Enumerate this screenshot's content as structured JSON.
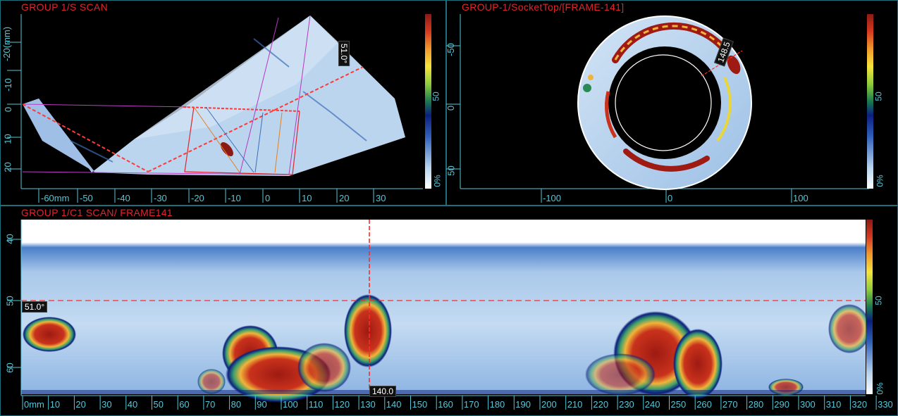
{
  "sscan": {
    "title": "GROUP 1/S SCAN",
    "y_ticks": [
      "-20",
      "-10",
      "0",
      "10",
      "20"
    ],
    "y_unit_label": "-20(mm)",
    "x_ticks": [
      "-60mm",
      "-50",
      "-40",
      "-30",
      "-20",
      "-10",
      "0",
      "10",
      "20",
      "30"
    ],
    "angle_badge": "51.0°",
    "colorbar_ticks": [
      "0%",
      "50"
    ]
  },
  "socket": {
    "title": "GROUP-1/SocketTop/[FRAME-141]",
    "y_ticks": [
      "-50",
      "0",
      "50"
    ],
    "x_ticks": [
      "-100",
      "0",
      "100"
    ],
    "angle_badge": "148.5",
    "colorbar_ticks": [
      "0%",
      "50"
    ]
  },
  "cscan": {
    "title": "GROUP 1/C1 SCAN/ FRAME141",
    "y_ticks": [
      "40",
      "50",
      "60"
    ],
    "x_ticks": [
      "0mm",
      "10",
      "20",
      "30",
      "40",
      "50",
      "60",
      "70",
      "80",
      "90",
      "100",
      "110",
      "120",
      "130",
      "140",
      "150",
      "160",
      "170",
      "180",
      "190",
      "200",
      "210",
      "220",
      "230",
      "240",
      "250",
      "260",
      "270",
      "280",
      "290",
      "300",
      "310",
      "320",
      "330"
    ],
    "angle_cursor_label": "51.0°",
    "position_cursor_label": "140.0",
    "colorbar_ticks": [
      "0%",
      "50"
    ]
  },
  "colors": {
    "title_red": "#e0262b",
    "axis_cyan": "#55c7d8",
    "frame": "#1e6f7c",
    "cursor_red": "#ff2a2a"
  }
}
